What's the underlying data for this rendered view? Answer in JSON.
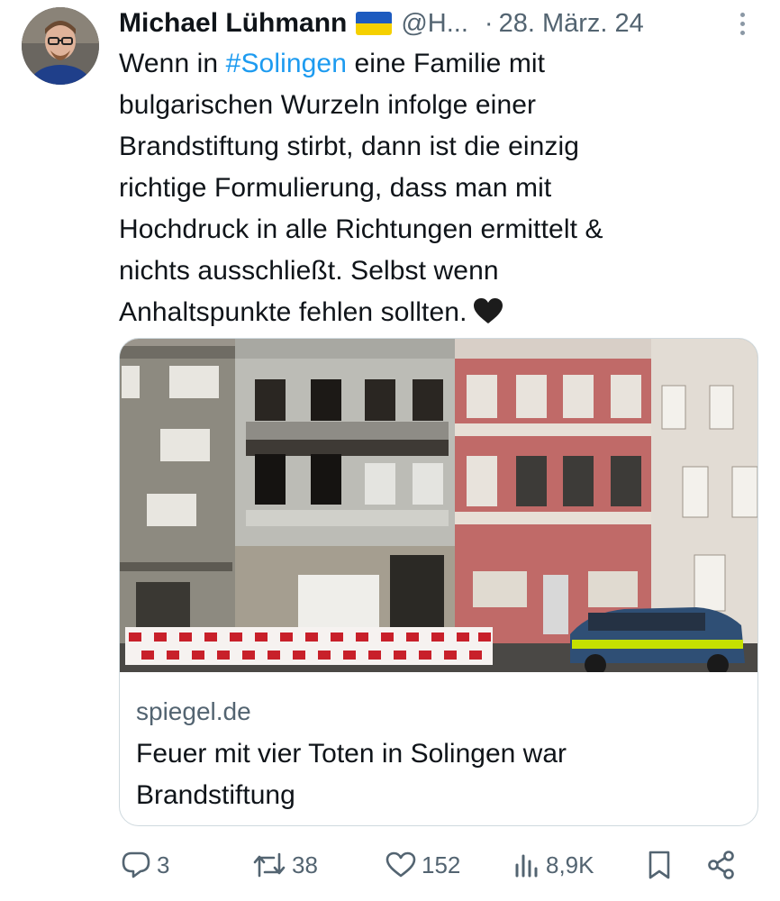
{
  "tweet": {
    "author_name": "Michael Lühmann",
    "handle": "@H...",
    "separator": "·",
    "date": "28. März. 24",
    "text_lines": [
      {
        "pre": "Wenn in ",
        "hashtag": "#Solingen",
        "post": " eine Familie mit"
      },
      {
        "pre": "bulgarischen Wurzeln infolge einer"
      },
      {
        "pre": "Brandstiftung stirbt, dann ist die einzig"
      },
      {
        "pre": "richtige Formulierung, dass man mit"
      },
      {
        "pre": "Hochdruck in alle Richtungen ermittelt &"
      },
      {
        "pre": "nichts ausschließt. Selbst wenn"
      },
      {
        "pre": "Anhaltspunkte fehlen sollten."
      }
    ],
    "emoji": "black-heart"
  },
  "card": {
    "domain": "spiegel.de",
    "title_lines": [
      "Feuer mit vier Toten in Solingen war",
      "Brandstiftung"
    ]
  },
  "actions": {
    "replies": "3",
    "retweets": "38",
    "likes": "152",
    "views": "8,9K"
  },
  "colors": {
    "text": "#0f1419",
    "secondary": "#536471",
    "hashtag": "#1d9bf0",
    "border": "#cfd9de"
  },
  "icons": [
    "reply-icon",
    "retweet-icon",
    "like-icon",
    "views-icon",
    "bookmark-icon",
    "share-icon",
    "more-icon",
    "ukraine-flag-icon"
  ]
}
